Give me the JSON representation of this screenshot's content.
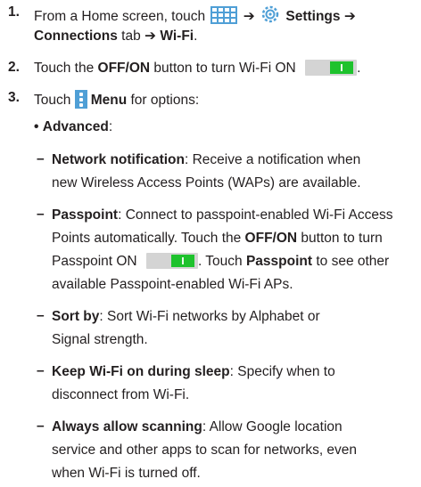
{
  "steps": [
    {
      "number": "1.",
      "l1_pre": "From a Home screen, touch",
      "arrow1": "➔",
      "settings": "Settings",
      "arrow2": "➔",
      "connections": "Connections",
      "tab": " tab ",
      "arrow3": "➔",
      "wifi": "Wi-Fi",
      "period": "."
    },
    {
      "number": "2.",
      "pre": "Touch the ",
      "button": "OFF/ON",
      "post": " button to turn Wi-Fi ON",
      "period": "."
    },
    {
      "number": "3.",
      "pre": "Touch",
      "menu": "Menu",
      "post": " for options:"
    }
  ],
  "advanced": {
    "bullet": "•",
    "label": "Advanced",
    "colon": ":"
  },
  "options": [
    {
      "dash": "–",
      "name": "Network notification",
      "l1": ": Receive a notification when",
      "l2": "new Wireless Access Points (WAPs) are available."
    },
    {
      "dash": "–",
      "name": "Passpoint",
      "l1": ": Connect to passpoint-enabled Wi-Fi Access",
      "l2": "Points automatically. Touch the ",
      "l2b": "OFF/ON",
      "l2c": " button to turn",
      "l3": "Passpoint ON",
      "l3b": ". Touch ",
      "l3c": "Passpoint",
      "l3d": " to see other",
      "l4": "available Passpoint-enabled Wi-Fi APs."
    },
    {
      "dash": "–",
      "name": "Sort by",
      "l1": ": Sort Wi-Fi networks by Alphabet or",
      "l2": "Signal strength."
    },
    {
      "dash": "–",
      "name": "Keep Wi-Fi on during sleep",
      "l1": ": Specify when to",
      "l2": "disconnect from Wi-Fi."
    },
    {
      "dash": "–",
      "name": "Always allow scanning",
      "l1": ": Allow Google location",
      "l2": "service and other apps to scan for networks, even",
      "l3": "when Wi-Fi is turned off."
    }
  ],
  "icons": {
    "apps": "apps-grid-icon",
    "settings": "settings-gear-icon",
    "menu": "menu-icon",
    "toggle": "on-toggle-icon"
  },
  "colors": {
    "accent_blue": "#4f9fd6",
    "toggle_green": "#1ec22d",
    "toggle_gray": "#d4d4d4"
  }
}
